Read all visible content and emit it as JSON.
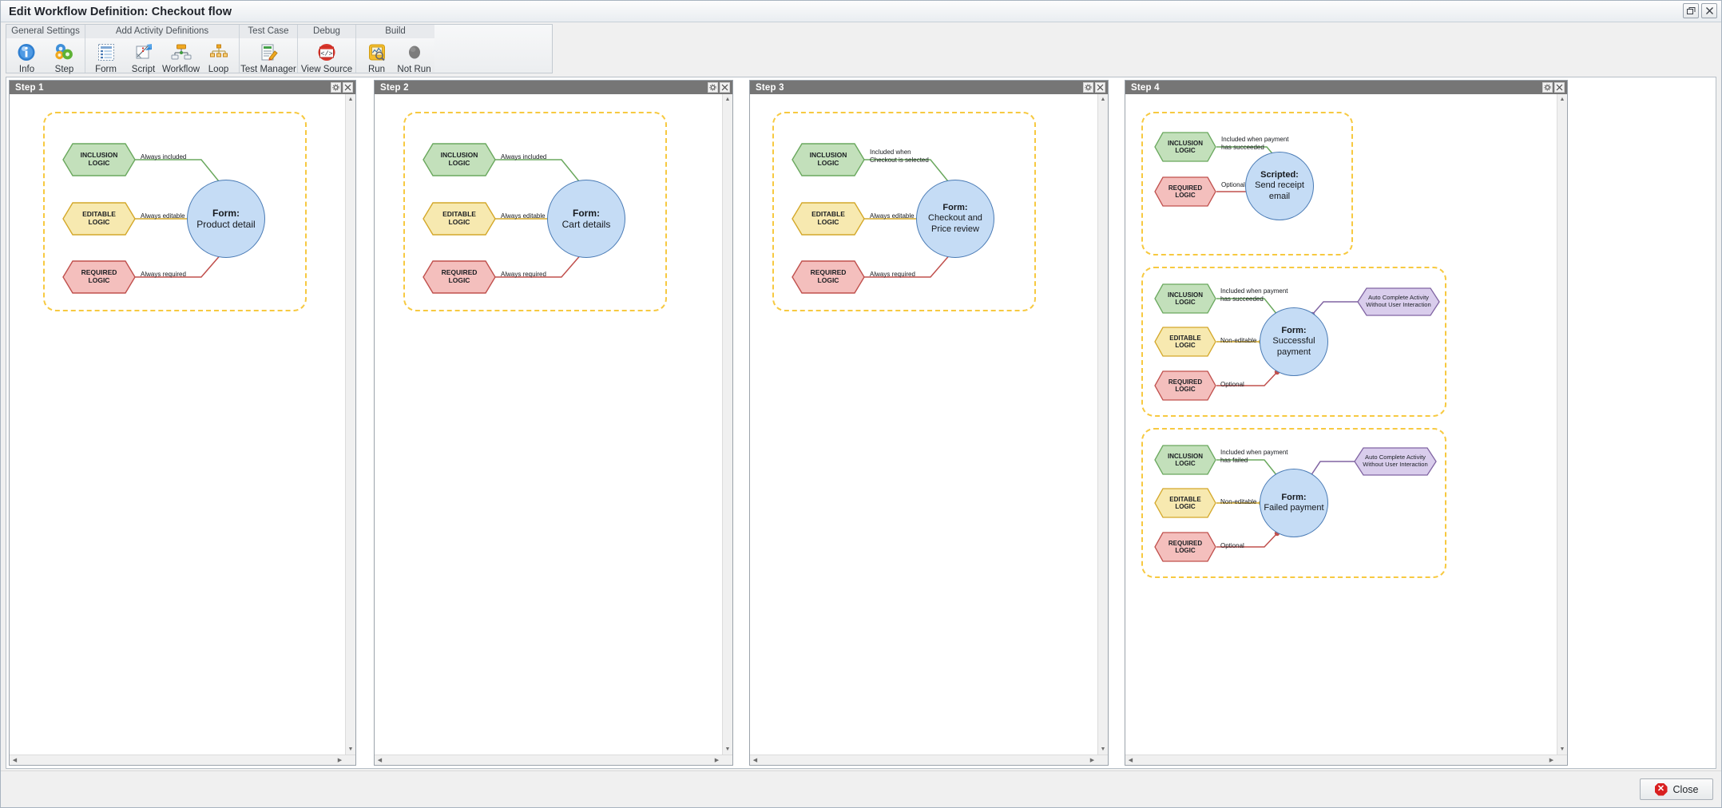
{
  "window": {
    "title": "Edit Workflow Definition: Checkout flow",
    "restore_icon": "restore-window-icon",
    "close_icon": "close-window-icon"
  },
  "ribbon": {
    "groups": [
      {
        "title": "General Settings",
        "buttons": [
          {
            "label": "Info",
            "icon": "info-icon"
          },
          {
            "label": "Step",
            "icon": "gears-icon"
          }
        ]
      },
      {
        "title": "Add Activity Definitions",
        "buttons": [
          {
            "label": "Form",
            "icon": "form-icon"
          },
          {
            "label": "Script",
            "icon": "script-icon"
          },
          {
            "label": "Workflow",
            "icon": "workflow-icon"
          },
          {
            "label": "Loop",
            "icon": "loop-icon"
          }
        ]
      },
      {
        "title": "Test Case",
        "buttons": [
          {
            "label": "Test Manager",
            "icon": "test-manager-icon"
          }
        ]
      },
      {
        "title": "Debug",
        "buttons": [
          {
            "label": "View Source",
            "icon": "view-source-icon"
          }
        ]
      },
      {
        "title": "Build",
        "buttons": [
          {
            "label": "Run",
            "icon": "run-icon"
          },
          {
            "label": "Not Run",
            "icon": "not-run-icon"
          }
        ]
      }
    ]
  },
  "panel_controls": {
    "settings_icon": "gear-icon",
    "close_icon": "close-icon",
    "scroll_up_icon": "triangle-up-icon",
    "scroll_down_icon": "triangle-down-icon",
    "scroll_left_icon": "triangle-left-icon",
    "scroll_right_icon": "triangle-right-icon"
  },
  "steps": [
    {
      "title": "Step 1",
      "activities": [
        {
          "node": {
            "kind": "Form:",
            "name": "Product detail"
          },
          "inclusion": {
            "label": "INCLUSION\nLOGIC",
            "edge": "Always included"
          },
          "editable": {
            "label": "EDITABLE\nLOGIC",
            "edge": "Always editable"
          },
          "required": {
            "label": "REQUIRED\nLOGIC",
            "edge": "Always required"
          },
          "auto": null
        }
      ]
    },
    {
      "title": "Step 2",
      "activities": [
        {
          "node": {
            "kind": "Form:",
            "name": "Cart details"
          },
          "inclusion": {
            "label": "INCLUSION\nLOGIC",
            "edge": "Always included"
          },
          "editable": {
            "label": "EDITABLE\nLOGIC",
            "edge": "Always editable"
          },
          "required": {
            "label": "REQUIRED\nLOGIC",
            "edge": "Always required"
          },
          "auto": null
        }
      ]
    },
    {
      "title": "Step 3",
      "activities": [
        {
          "node": {
            "kind": "Form:",
            "name": "Checkout and\nPrice review"
          },
          "inclusion": {
            "label": "INCLUSION\nLOGIC",
            "edge": "Included when\nCheckout is selected"
          },
          "editable": {
            "label": "EDITABLE\nLOGIC",
            "edge": "Always editable"
          },
          "required": {
            "label": "REQUIRED\nLOGIC",
            "edge": "Always required"
          },
          "auto": null
        }
      ]
    },
    {
      "title": "Step 4",
      "activities": [
        {
          "node": {
            "kind": "Scripted:",
            "name": "Send receipt\nemail"
          },
          "inclusion": {
            "label": "INCLUSION\nLOGIC",
            "edge": "Included when payment\nhas succeeded"
          },
          "editable": null,
          "required": {
            "label": "REQUIRED\nLOGIC",
            "edge": "Optional"
          },
          "auto": null
        },
        {
          "node": {
            "kind": "Form:",
            "name": "Successful\npayment"
          },
          "inclusion": {
            "label": "INCLUSION\nLOGIC",
            "edge": "Included when payment\nhas succeeded"
          },
          "editable": {
            "label": "EDITABLE\nLOGIC",
            "edge": "Non-editable"
          },
          "required": {
            "label": "REQUIRED\nLOGIC",
            "edge": "Optional"
          },
          "auto": {
            "label": "Auto Complete Activity\nWithout User Interaction"
          }
        },
        {
          "node": {
            "kind": "Form:",
            "name": "Failed payment"
          },
          "inclusion": {
            "label": "INCLUSION\nLOGIC",
            "edge": "Included when payment\nhas failed"
          },
          "editable": {
            "label": "EDITABLE\nLOGIC",
            "edge": "Non-editable"
          },
          "required": {
            "label": "REQUIRED\nLOGIC",
            "edge": "Optional"
          },
          "auto": {
            "label": "Auto Complete Activity\nWithout User Interaction"
          }
        }
      ]
    }
  ],
  "footer": {
    "close_label": "Close",
    "close_icon": "close-octagon-icon"
  },
  "colors": {
    "panel_header": "#767676",
    "group_dashed": "#f7c940",
    "inclusion_fill": "#c3e0bb",
    "inclusion_stroke": "#6aa85e",
    "editable_fill": "#f7e9b0",
    "editable_stroke": "#d4a82a",
    "required_fill": "#f4bfbd",
    "required_stroke": "#c0504d",
    "auto_fill": "#d9cdec",
    "auto_stroke": "#8064a2",
    "node_fill": "#c5dcf5",
    "node_stroke": "#4a7bb5",
    "accent_close": "#d92020"
  }
}
